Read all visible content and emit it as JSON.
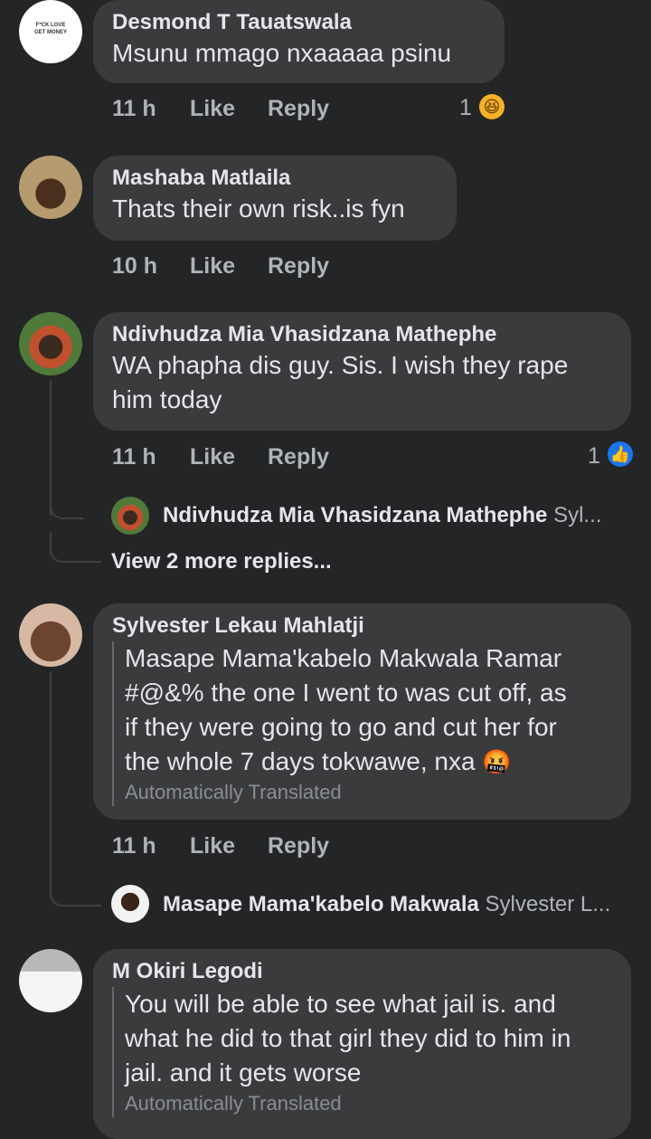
{
  "comments": [
    {
      "author": "Desmond T Tauatswala",
      "avatar_text": "F*CK LOVE GET MONEY",
      "text": "Msunu mmago nxaaaaa psinu",
      "time": "11 h",
      "like": "Like",
      "reply": "Reply",
      "reaction_count": "1",
      "reaction_icon": "laugh-emoji"
    },
    {
      "author": "Mashaba Matlaila",
      "text": "Thats their own risk..is fyn",
      "time": "10 h",
      "like": "Like",
      "reply": "Reply"
    },
    {
      "author": "Ndivhudza Mia Vhasidzana Mathephe",
      "text_line1": "WA phapha dis guy. Sis. I wish they rape",
      "text_line2": "him today",
      "time": "11 h",
      "like": "Like",
      "reply": "Reply",
      "reaction_count": "1",
      "reaction_icon": "thumbs-up-emoji",
      "reply_preview": {
        "author": "Ndivhudza Mia Vhasidzana Mathephe",
        "snippet": "Syl..."
      },
      "view_more": "View 2 more replies..."
    },
    {
      "author": "Sylvester Lekau Mahlatji",
      "lines": [
        "Masape Mama'kabelo Makwala Ramar",
        "#@&% the one I went to was cut off, as",
        "if they were going to go and cut her for",
        "the whole 7 days tokwawe, nxa"
      ],
      "emoji": "🤬",
      "translated": "Automatically Translated",
      "time": "11 h",
      "like": "Like",
      "reply": "Reply",
      "reply_preview": {
        "author": "Masape Mama'kabelo Makwala",
        "snippet": "Sylvester L..."
      }
    },
    {
      "author": "M Okiri Legodi",
      "lines": [
        "You will be able to see what jail is. and",
        "what he did to that girl they did to him in",
        "jail. and it gets worse"
      ],
      "translated": "Automatically Translated"
    }
  ],
  "colors": {
    "background": "#242526",
    "bubble": "#3a3b3c",
    "like_blue": "#1877f2"
  }
}
